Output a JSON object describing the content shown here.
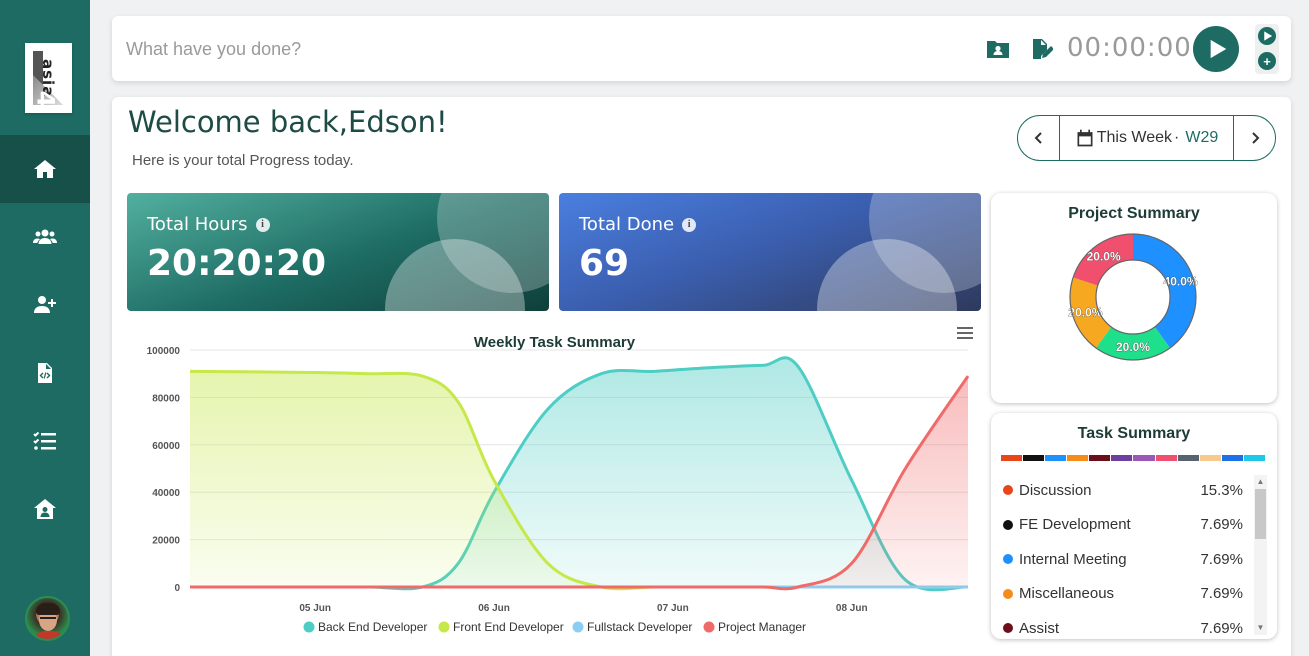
{
  "sidebar": {
    "logo_text": "asia",
    "logo_digit": "4",
    "nav_items": [
      {
        "icon": "home-icon"
      },
      {
        "icon": "users-icon"
      },
      {
        "icon": "add-user-icon"
      },
      {
        "icon": "code-file-icon"
      },
      {
        "icon": "task-list-icon"
      },
      {
        "icon": "house-user-icon"
      }
    ]
  },
  "timer": {
    "placeholder": "What have you done?",
    "time": "00:00:00"
  },
  "header": {
    "welcome": "Welcome back,Edson!",
    "subtitle": "Here is your total Progress today.",
    "week_label": "This Week",
    "week_sep": "·",
    "week_code": "W29"
  },
  "stats": {
    "total_hours_label": "Total Hours",
    "total_hours_value": "20:20:20",
    "total_done_label": "Total Done",
    "total_done_value": "69"
  },
  "chart_data": {
    "type": "area",
    "title": "Weekly Task Summary",
    "categories": [
      "05 Jun",
      "06 Jun",
      "07 Jun",
      "08 Jun"
    ],
    "x": [
      4.3,
      5.0,
      5.3,
      5.6,
      5.8,
      6.0,
      6.3,
      6.6,
      6.9,
      7.2,
      7.5,
      7.7,
      8.0,
      8.3,
      8.65
    ],
    "ylim": [
      0,
      100000
    ],
    "yticks": [
      "0",
      "20000",
      "40000",
      "60000",
      "80000",
      "100000"
    ],
    "series": [
      {
        "name": "Back End Developer",
        "color": "#4ecdc4",
        "values": [
          0,
          0,
          0,
          0,
          10000,
          40000,
          75000,
          90000,
          91000,
          92500,
          93500,
          93000,
          45000,
          3000,
          0
        ]
      },
      {
        "name": "Front End Developer",
        "color": "#c5e84a",
        "values": [
          91000,
          90500,
          90000,
          89000,
          78000,
          45000,
          10000,
          0,
          0,
          0,
          0,
          0,
          0,
          0,
          0
        ]
      },
      {
        "name": "Fullstack Developer",
        "color": "#8bcff0",
        "values": [
          0,
          0,
          0,
          0,
          0,
          0,
          0,
          0,
          0,
          0,
          0,
          0,
          0,
          0,
          0
        ]
      },
      {
        "name": "Project Manager",
        "color": "#f06a6a",
        "values": [
          0,
          0,
          0,
          0,
          0,
          0,
          0,
          0,
          0,
          0,
          0,
          0,
          10000,
          50000,
          89000
        ]
      }
    ],
    "grid": true,
    "legend": "bottom"
  },
  "project_summary": {
    "title": "Project Summary",
    "slices": [
      {
        "label": "40.0%",
        "value": 40,
        "color": "#1e90ff"
      },
      {
        "label": "20.0%",
        "value": 20,
        "color": "#1ee08a"
      },
      {
        "label": "20.0%",
        "value": 20,
        "color": "#f6a821"
      },
      {
        "label": "20.0%",
        "value": 20,
        "color": "#f0506e"
      }
    ]
  },
  "task_summary": {
    "title": "Task Summary",
    "bar_colors": [
      "#e8451a",
      "#111111",
      "#1e90ff",
      "#f58c1a",
      "#6b0f1a",
      "#6c3fa0",
      "#9b59b6",
      "#f0506e",
      "#5a6270",
      "#f7c98b",
      "#1e6fe8",
      "#1ec8e8"
    ],
    "items": [
      {
        "name": "Discussion",
        "pct": "15.3%",
        "color": "#e8451a"
      },
      {
        "name": "FE Development",
        "pct": "7.69%",
        "color": "#111111"
      },
      {
        "name": "Internal Meeting",
        "pct": "7.69%",
        "color": "#1e90ff"
      },
      {
        "name": "Miscellaneous",
        "pct": "7.69%",
        "color": "#f58c1a"
      },
      {
        "name": "Assist",
        "pct": "7.69%",
        "color": "#6b0f1a"
      }
    ]
  }
}
